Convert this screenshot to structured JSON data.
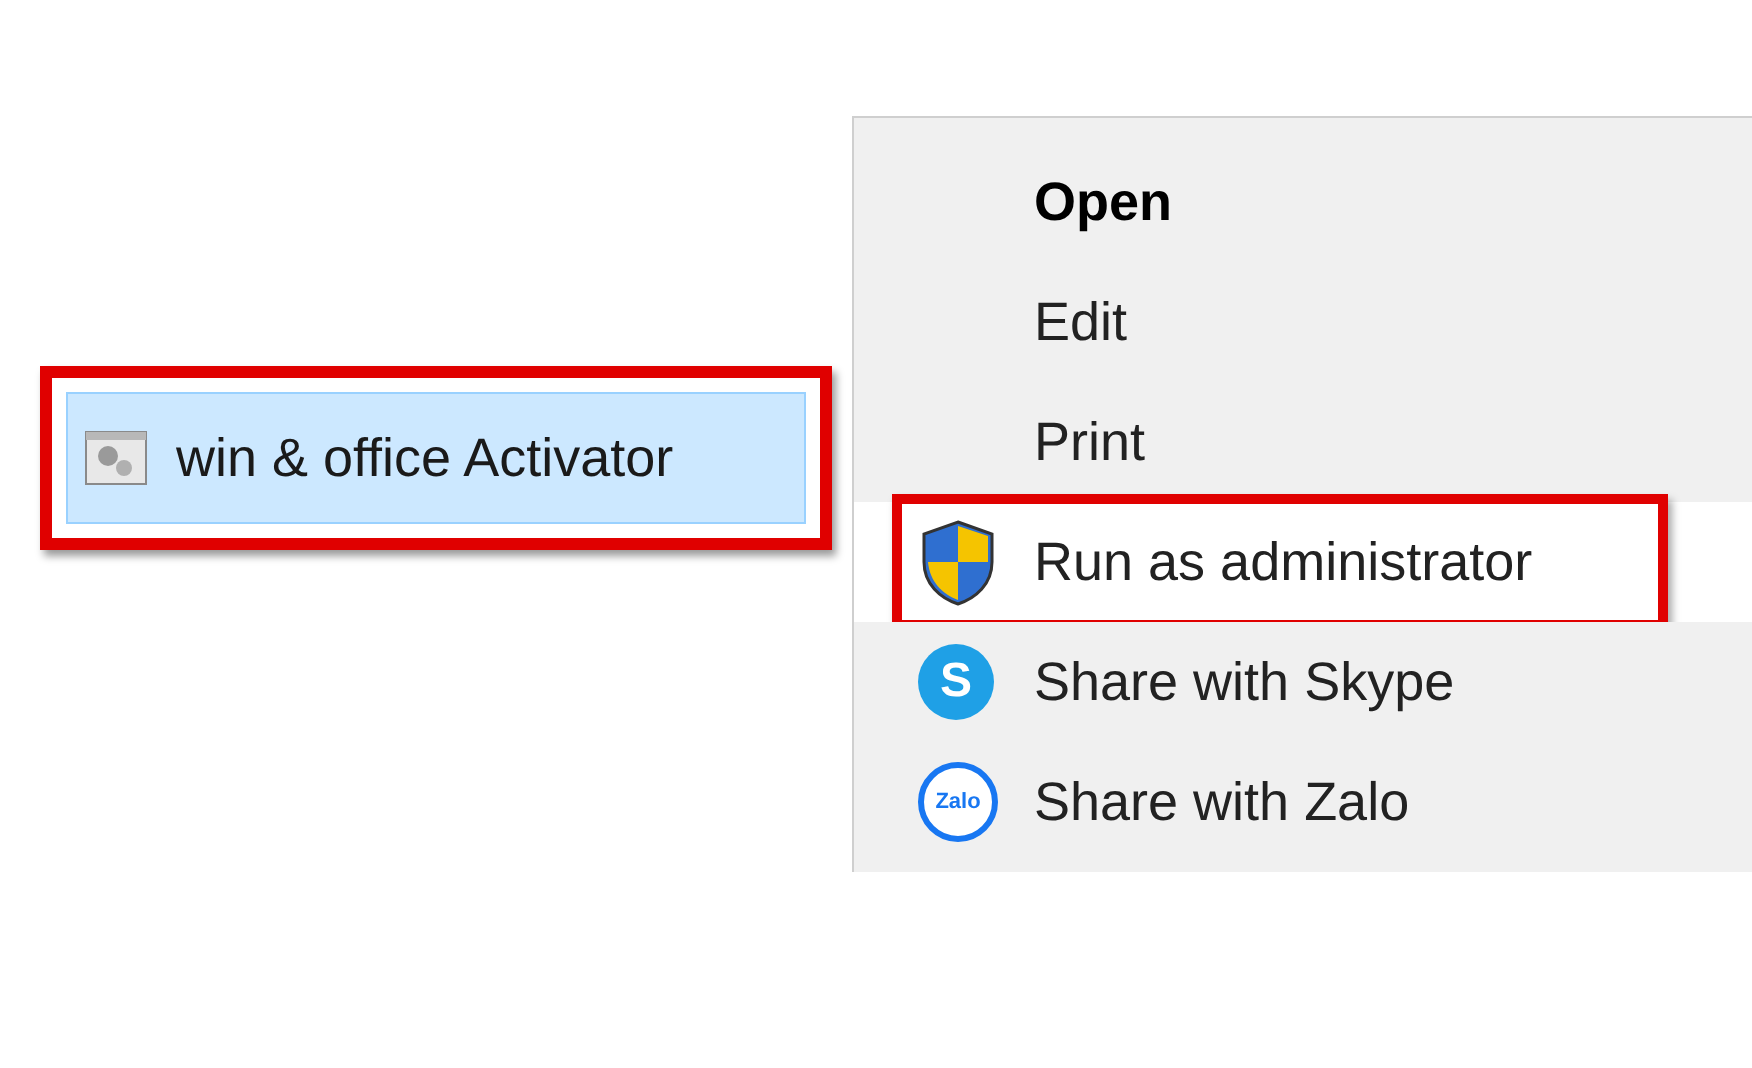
{
  "file_item": {
    "label": "win & office Activator",
    "selected": true,
    "highlighted": true
  },
  "context_menu": {
    "items": [
      {
        "label": "Open",
        "default": true,
        "selected": false,
        "highlighted": false
      },
      {
        "label": "Edit",
        "default": false,
        "selected": false,
        "highlighted": false
      },
      {
        "label": "Print",
        "default": false,
        "selected": false,
        "highlighted": false
      },
      {
        "label": "Run as administrator",
        "kind": "shield",
        "default": false,
        "selected": true,
        "highlighted": true
      },
      {
        "label": "Share with Skype",
        "kind": "skype",
        "icon_label": "S",
        "default": false,
        "selected": false,
        "highlighted": false
      },
      {
        "label": "Share with Zalo",
        "kind": "zalo",
        "icon_label": "Zalo",
        "default": false,
        "selected": false,
        "highlighted": false
      }
    ]
  }
}
